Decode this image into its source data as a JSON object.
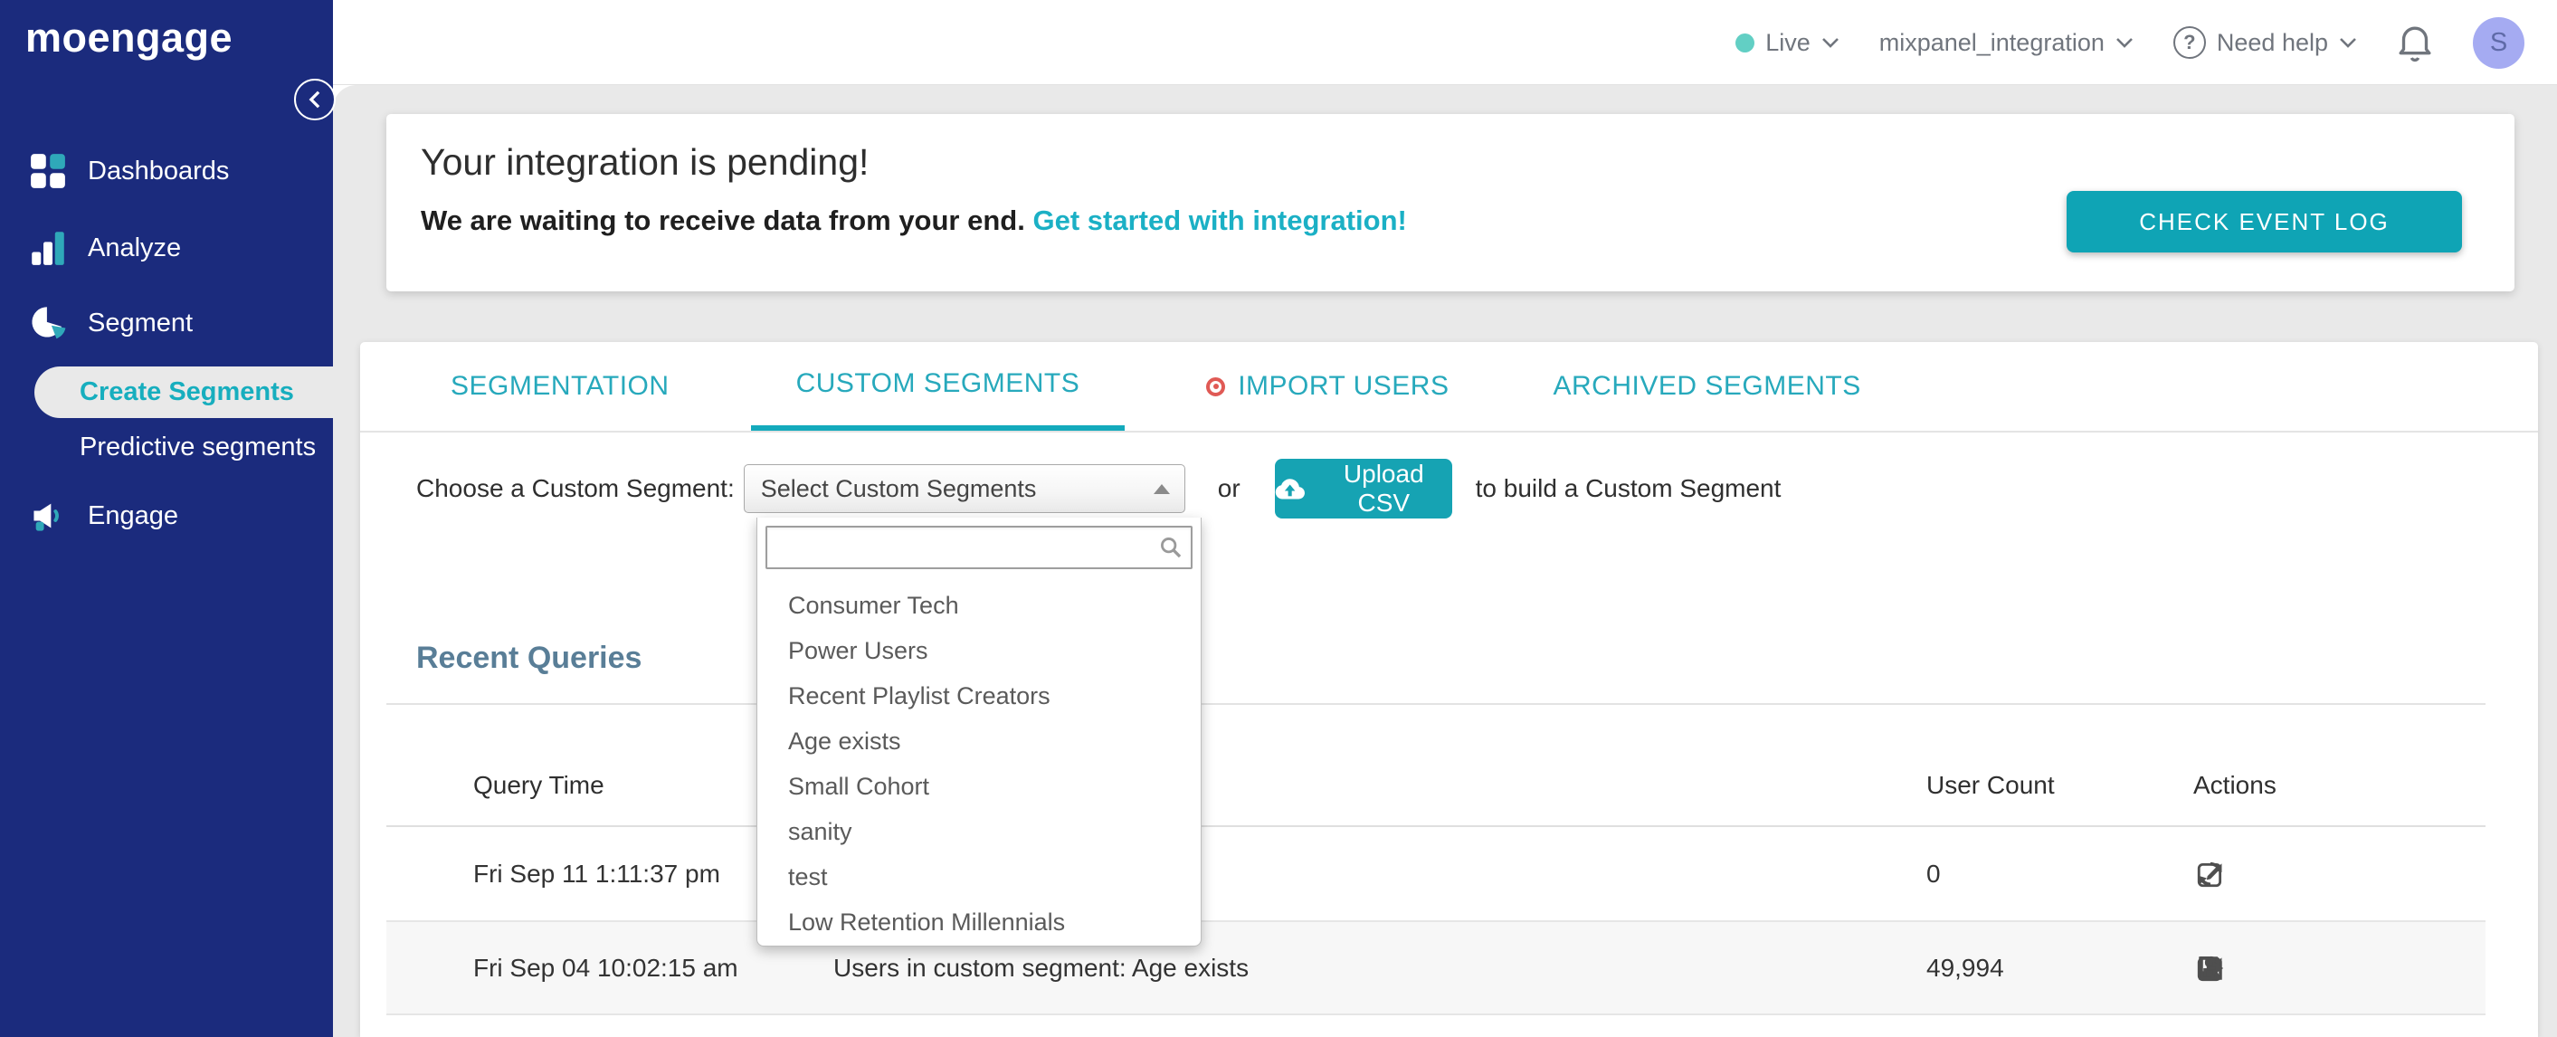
{
  "sidebar": {
    "logo_text": "moengage",
    "items": [
      {
        "label": "Dashboards",
        "icon": "dashboards-grid-icon"
      },
      {
        "label": "Analyze",
        "icon": "analyze-bars-icon"
      },
      {
        "label": "Segment",
        "icon": "segment-pie-icon"
      },
      {
        "label": "Engage",
        "icon": "engage-megaphone-icon"
      }
    ],
    "sub_items": [
      {
        "label": "Create Segments",
        "active": true
      },
      {
        "label": "Predictive segments",
        "active": false
      }
    ]
  },
  "topbar": {
    "environment": "Live",
    "app_name": "mixpanel_integration",
    "help_label": "Need help",
    "avatar_initial": "S"
  },
  "banner": {
    "title": "Your integration is pending!",
    "message": "We are waiting to receive data from your end.",
    "link_text": "Get started with integration!",
    "button_label": "CHECK EVENT LOG"
  },
  "tabs": [
    {
      "label": "SEGMENTATION",
      "active": false
    },
    {
      "label": "CUSTOM SEGMENTS",
      "active": true
    },
    {
      "label": "IMPORT USERS",
      "active": false,
      "has_dot": true
    },
    {
      "label": "ARCHIVED SEGMENTS",
      "active": false
    }
  ],
  "segment_chooser": {
    "label": "Choose a Custom Segment:",
    "select_value": "Select Custom Segments",
    "or_text": "or",
    "upload_button_label": "Upload CSV",
    "suffix_text": "to build a Custom Segment",
    "search_value": "",
    "dropdown_options": [
      "Consumer Tech",
      "Power Users",
      "Recent Playlist Creators",
      "Age exists",
      "Small Cohort",
      "sanity",
      "test",
      "Low Retention Millennials"
    ]
  },
  "recent_queries": {
    "title": "Recent Queries",
    "columns": {
      "time": "Query Time",
      "count": "User Count",
      "actions": "Actions"
    },
    "rows": [
      {
        "query_time": "Fri Sep 11 1:11:37 pm",
        "query": "",
        "user_count": "0",
        "actions": [
          "refresh",
          "edit"
        ]
      },
      {
        "query_time": "Fri Sep 04 10:02:15 am",
        "query": "Users in custom segment: Age exists",
        "user_count": "49,994",
        "actions": [
          "refresh",
          "edit",
          "user",
          "save",
          "export"
        ]
      }
    ]
  },
  "colors": {
    "navy": "#1B2B7D",
    "accent_teal": "#14A3B4",
    "link_teal": "#1BB0C5",
    "active_item_teal": "#17AEBE",
    "live_dot": "#62CFC4",
    "page_bg": "#E9E9E9",
    "alt_row_bg": "#F7F7F7",
    "heading_slate": "#597E97",
    "import_dot_red": "#E05A55",
    "avatar_bg": "#A5ABF2"
  }
}
